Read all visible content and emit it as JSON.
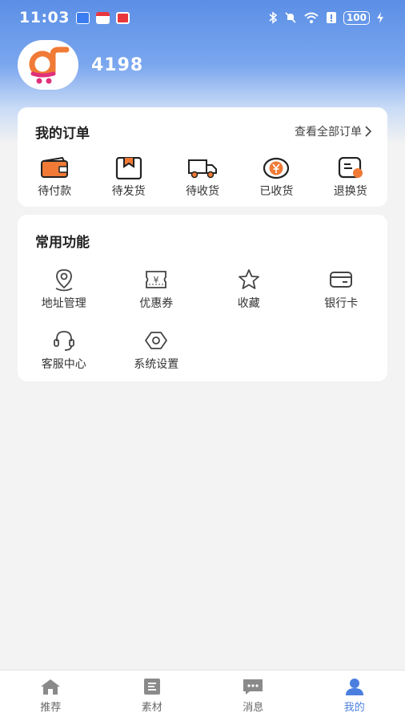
{
  "status_bar": {
    "time": "11:03",
    "battery": "100",
    "app_icon_colors": [
      "#3b7cf0",
      "#e8383d",
      "#e8383d"
    ]
  },
  "profile": {
    "username": "4198",
    "avatar_icon": "shop-cart-logo"
  },
  "orders": {
    "title": "我的订单",
    "view_all": "查看全部订单",
    "items": [
      {
        "label": "待付款",
        "icon": "wallet-icon"
      },
      {
        "label": "待发货",
        "icon": "package-icon"
      },
      {
        "label": "待收货",
        "icon": "truck-icon"
      },
      {
        "label": "已收货",
        "icon": "yen-coin-icon"
      },
      {
        "label": "退换货",
        "icon": "return-icon"
      }
    ]
  },
  "functions": {
    "title": "常用功能",
    "items": [
      {
        "label": "地址管理",
        "icon": "location-icon"
      },
      {
        "label": "优惠券",
        "icon": "coupon-icon"
      },
      {
        "label": "收藏",
        "icon": "star-icon"
      },
      {
        "label": "银行卡",
        "icon": "bank-card-icon"
      },
      {
        "label": "客服中心",
        "icon": "headset-icon"
      },
      {
        "label": "系统设置",
        "icon": "settings-icon"
      }
    ]
  },
  "tabbar": {
    "items": [
      {
        "label": "推荐",
        "icon": "home-icon",
        "active": false
      },
      {
        "label": "素材",
        "icon": "material-icon",
        "active": false
      },
      {
        "label": "消息",
        "icon": "message-icon",
        "active": false
      },
      {
        "label": "我的",
        "icon": "profile-icon",
        "active": true
      }
    ]
  },
  "colors": {
    "accent_orange": "#f07a36",
    "active_tab": "#4a7fe0",
    "header_blue": "#5b8fe6"
  }
}
